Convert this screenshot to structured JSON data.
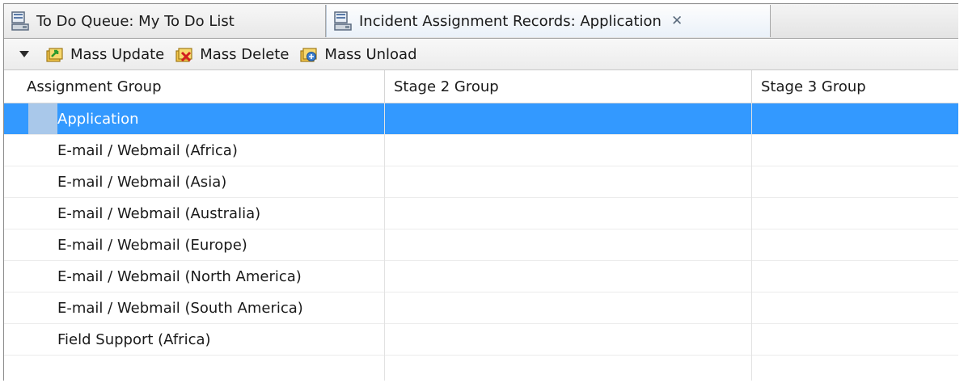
{
  "tabs": [
    {
      "label": "To Do Queue: My To Do List",
      "icon": "queue-icon"
    },
    {
      "label": "Incident Assignment Records:  Application",
      "icon": "queue-icon",
      "active": true,
      "close_icon": "close-icon"
    }
  ],
  "toolbar": {
    "dropdown_icon": "dropdown-arrow-icon",
    "mass_update_label": "Mass Update",
    "mass_delete_label": "Mass Delete",
    "mass_unload_label": "Mass Unload"
  },
  "table": {
    "columns": [
      "Assignment Group",
      "Stage 2 Group",
      "Stage 3 Group"
    ],
    "rows": [
      {
        "assignment_group": "Application",
        "stage2": "",
        "stage3": "",
        "selected": true
      },
      {
        "assignment_group": "E-mail / Webmail (Africa)",
        "stage2": "",
        "stage3": ""
      },
      {
        "assignment_group": "E-mail / Webmail (Asia)",
        "stage2": "",
        "stage3": ""
      },
      {
        "assignment_group": "E-mail / Webmail (Australia)",
        "stage2": "",
        "stage3": ""
      },
      {
        "assignment_group": "E-mail / Webmail (Europe)",
        "stage2": "",
        "stage3": ""
      },
      {
        "assignment_group": "E-mail / Webmail (North America)",
        "stage2": "",
        "stage3": ""
      },
      {
        "assignment_group": "E-mail / Webmail (South America)",
        "stage2": "",
        "stage3": ""
      },
      {
        "assignment_group": "Field Support (Africa)",
        "stage2": "",
        "stage3": ""
      }
    ]
  },
  "colors": {
    "selection": "#3399ff",
    "selection_marker": "#a9c8ea",
    "active_tab": "#eaf1f9"
  }
}
